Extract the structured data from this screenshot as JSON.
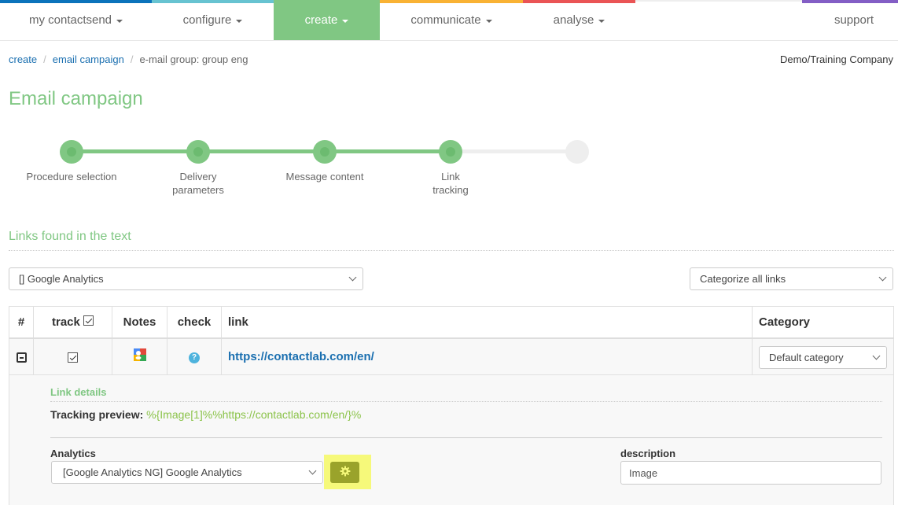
{
  "nav": {
    "items": [
      {
        "label": "my contactsend",
        "dropdown": true,
        "active": false,
        "color": "#0b73bb"
      },
      {
        "label": "configure",
        "dropdown": true,
        "active": false,
        "color": "#67c3d1"
      },
      {
        "label": "create",
        "dropdown": true,
        "active": true,
        "color": "#80c783"
      },
      {
        "label": "communicate",
        "dropdown": true,
        "active": false,
        "color": "#f9b234"
      },
      {
        "label": "analyse",
        "dropdown": true,
        "active": false,
        "color": "#ea5455"
      },
      {
        "label": "support",
        "dropdown": false,
        "active": false,
        "color": "#835ec5"
      }
    ]
  },
  "breadcrumb": {
    "items": [
      "create",
      "email campaign"
    ],
    "current": "e-mail group: group eng"
  },
  "company": "Demo/Training Company",
  "page_title": "Email campaign",
  "stepper": {
    "steps": [
      {
        "label_line1": "Procedure selection",
        "label_line2": "",
        "state": "done"
      },
      {
        "label_line1": "Delivery",
        "label_line2": "parameters",
        "state": "done"
      },
      {
        "label_line1": "Message content",
        "label_line2": "",
        "state": "done"
      },
      {
        "label_line1": "Link",
        "label_line2": "tracking",
        "state": "current"
      },
      {
        "label_line1": "",
        "label_line2": "",
        "state": "todo"
      }
    ]
  },
  "links_section": {
    "title": "Links found in the text",
    "analytics_select": "[] Google Analytics",
    "categorize_select": "Categorize all links"
  },
  "table": {
    "headers": {
      "num": "#",
      "track": "track",
      "notes": "Notes",
      "check": "check",
      "link": "link",
      "category": "Category"
    },
    "rows": [
      {
        "expanded": true,
        "tracked": true,
        "notes_icon": "google-icon",
        "check_icon": "question-icon",
        "check_glyph": "?",
        "link": "https://contactlab.com/en/",
        "category": "Default category"
      }
    ]
  },
  "link_details": {
    "title": "Link details",
    "tracking_preview_label": "Tracking preview:",
    "tracking_preview_value": "%{Image[1]%%https://contactlab.com/en/}%",
    "analytics_label": "Analytics",
    "analytics_value": "[Google Analytics NG] Google Analytics",
    "settings_icon": "gear-icon",
    "description_label": "description",
    "description_value": "Image"
  }
}
